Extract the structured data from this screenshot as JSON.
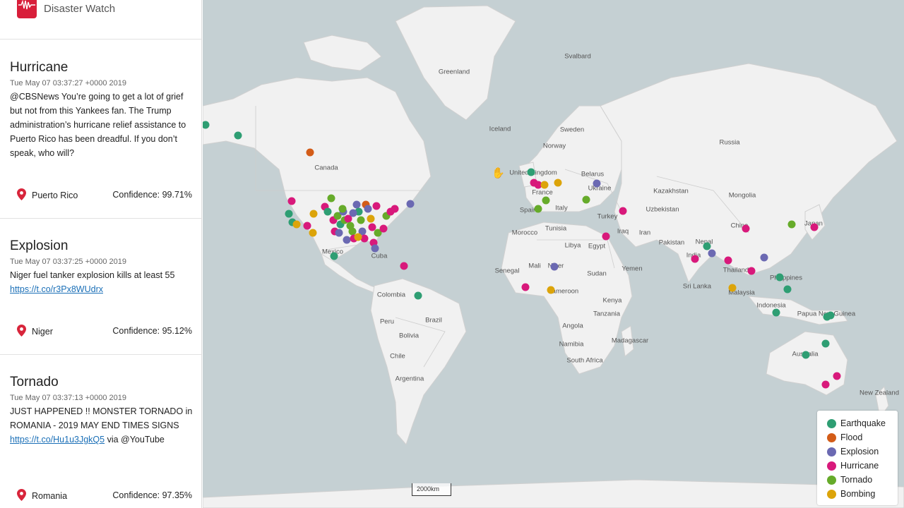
{
  "app": {
    "title": "Disaster Watch"
  },
  "cards": [
    {
      "title": "Hurricane",
      "time": "Tue May 07 03:37:27 +0000 2019",
      "text": "@CBSNews You’re going to get a lot of grief but not from this Yankees fan. The Trump administration’s hurricane relief assistance to Puerto Rico has been dreadful. If you don’t speak, who will?",
      "location": "Puerto Rico",
      "confidence": "Confidence: 99.71%"
    },
    {
      "title": "Explosion",
      "time": "Tue May 07 03:37:25 +0000 2019",
      "text": "Niger fuel tanker explosion kills at least 55",
      "link": "https://t.co/r3Px8WUdrx",
      "location": "Niger",
      "confidence": "Confidence: 95.12%"
    },
    {
      "title": "Tornado",
      "time": "Tue May 07 03:37:13 +0000 2019",
      "text": "JUST HAPPENED !! MONSTER TORNADO in ROMANIA - 2019 MAY END TIMES SIGNS",
      "link": "https://t.co/Hu1u3JgkQ5",
      "text_after": " via @YouTube",
      "location": "Romania",
      "confidence": "Confidence: 97.35%"
    }
  ],
  "legend": [
    {
      "label": "Earthquake",
      "color": "#2e9e73"
    },
    {
      "label": "Flood",
      "color": "#d35c18"
    },
    {
      "label": "Explosion",
      "color": "#6b69b2"
    },
    {
      "label": "Hurricane",
      "color": "#d8197b"
    },
    {
      "label": "Tornado",
      "color": "#66ab2a"
    },
    {
      "label": "Bombing",
      "color": "#dca40a"
    }
  ],
  "map": {
    "scale_label": "2000km",
    "labels": [
      "Greenland",
      "Svalbard",
      "Iceland",
      "Sweden",
      "Norway",
      "Russia",
      "Canada",
      "United Kingdom",
      "Belarus",
      "Ukraine",
      "France",
      "Spain",
      "Italy",
      "Kazakhstan",
      "Mongolia",
      "Uzbekistan",
      "Turkey",
      "Morocco",
      "Tunisia",
      "Iraq",
      "Iran",
      "Libya",
      "Egypt",
      "China",
      "Japan",
      "Pakistan",
      "Nepal",
      "India",
      "Mexico",
      "Cuba",
      "Mali",
      "Niger",
      "Senegal",
      "Sudan",
      "Yemen",
      "Thailand",
      "Philippines",
      "Colombia",
      "Brazil",
      "Peru",
      "Bolivia",
      "Sri Lanka",
      "Cameroon",
      "Kenya",
      "Tanzania",
      "Malaysia",
      "Indonesia",
      "Papua New Guinea",
      "Angola",
      "Madagascar",
      "Namibia",
      "Chile",
      "South Africa",
      "Australia",
      "Argentina",
      "New Zealand"
    ]
  }
}
